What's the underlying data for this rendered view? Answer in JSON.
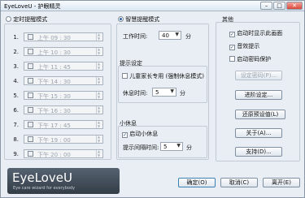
{
  "window": {
    "title": "EyeLoveU - 护眼精灵",
    "min_label": "–",
    "max_label": "□",
    "close_label": "✕"
  },
  "left": {
    "mode_label": "定时提醒模式",
    "rows": [
      {
        "num": "1.",
        "time": "上午 09 : 30"
      },
      {
        "num": "2.",
        "time": "上午 10 : 30"
      },
      {
        "num": "3.",
        "time": "上午 11 : 45"
      },
      {
        "num": "4.",
        "time": "下午 14 : 30"
      },
      {
        "num": "5.",
        "time": "下午 15 : 30"
      },
      {
        "num": "6.",
        "time": "下午 16 : 30"
      },
      {
        "num": "7.",
        "time": "下午 17 : 45"
      },
      {
        "num": "8.",
        "time": "下午 19 : 00"
      },
      {
        "num": "9.",
        "time": "下午 20 : 00"
      }
    ]
  },
  "middle": {
    "smart_mode_label": "智慧提醒模式",
    "work_time_label": "工作时间:",
    "work_time_value": "40",
    "work_time_unit": "分",
    "reminder_title": "提示设定",
    "parent_mode_label": "儿童家长专用 (强制休息模式)",
    "rest_time_label": "休息时间:",
    "rest_time_value": "5",
    "rest_time_unit": "分",
    "short_break_title": "小休息",
    "enable_short_break_label": "启动小休息",
    "short_interval_label": "提示间隔时间:",
    "short_interval_value": "5",
    "short_interval_unit": "分"
  },
  "right": {
    "title": "其他",
    "checks": [
      {
        "label": "启动时显示此画面",
        "checked": true
      },
      {
        "label": "音效提示",
        "checked": true
      },
      {
        "label": "启动密码保护",
        "checked": false
      }
    ],
    "set_password": "设定密码(P)...",
    "advanced": "进阶设定...",
    "restore_default": "还原预设值(L)",
    "about": "关于(A)...",
    "support": "支持(D)..."
  },
  "logo": {
    "name": "EyeLoveU",
    "tagline": "Eye care wizard for everybody"
  },
  "footer": {
    "ok": "确定(O)",
    "cancel": "取消(C)",
    "exit": "离开(E)"
  }
}
